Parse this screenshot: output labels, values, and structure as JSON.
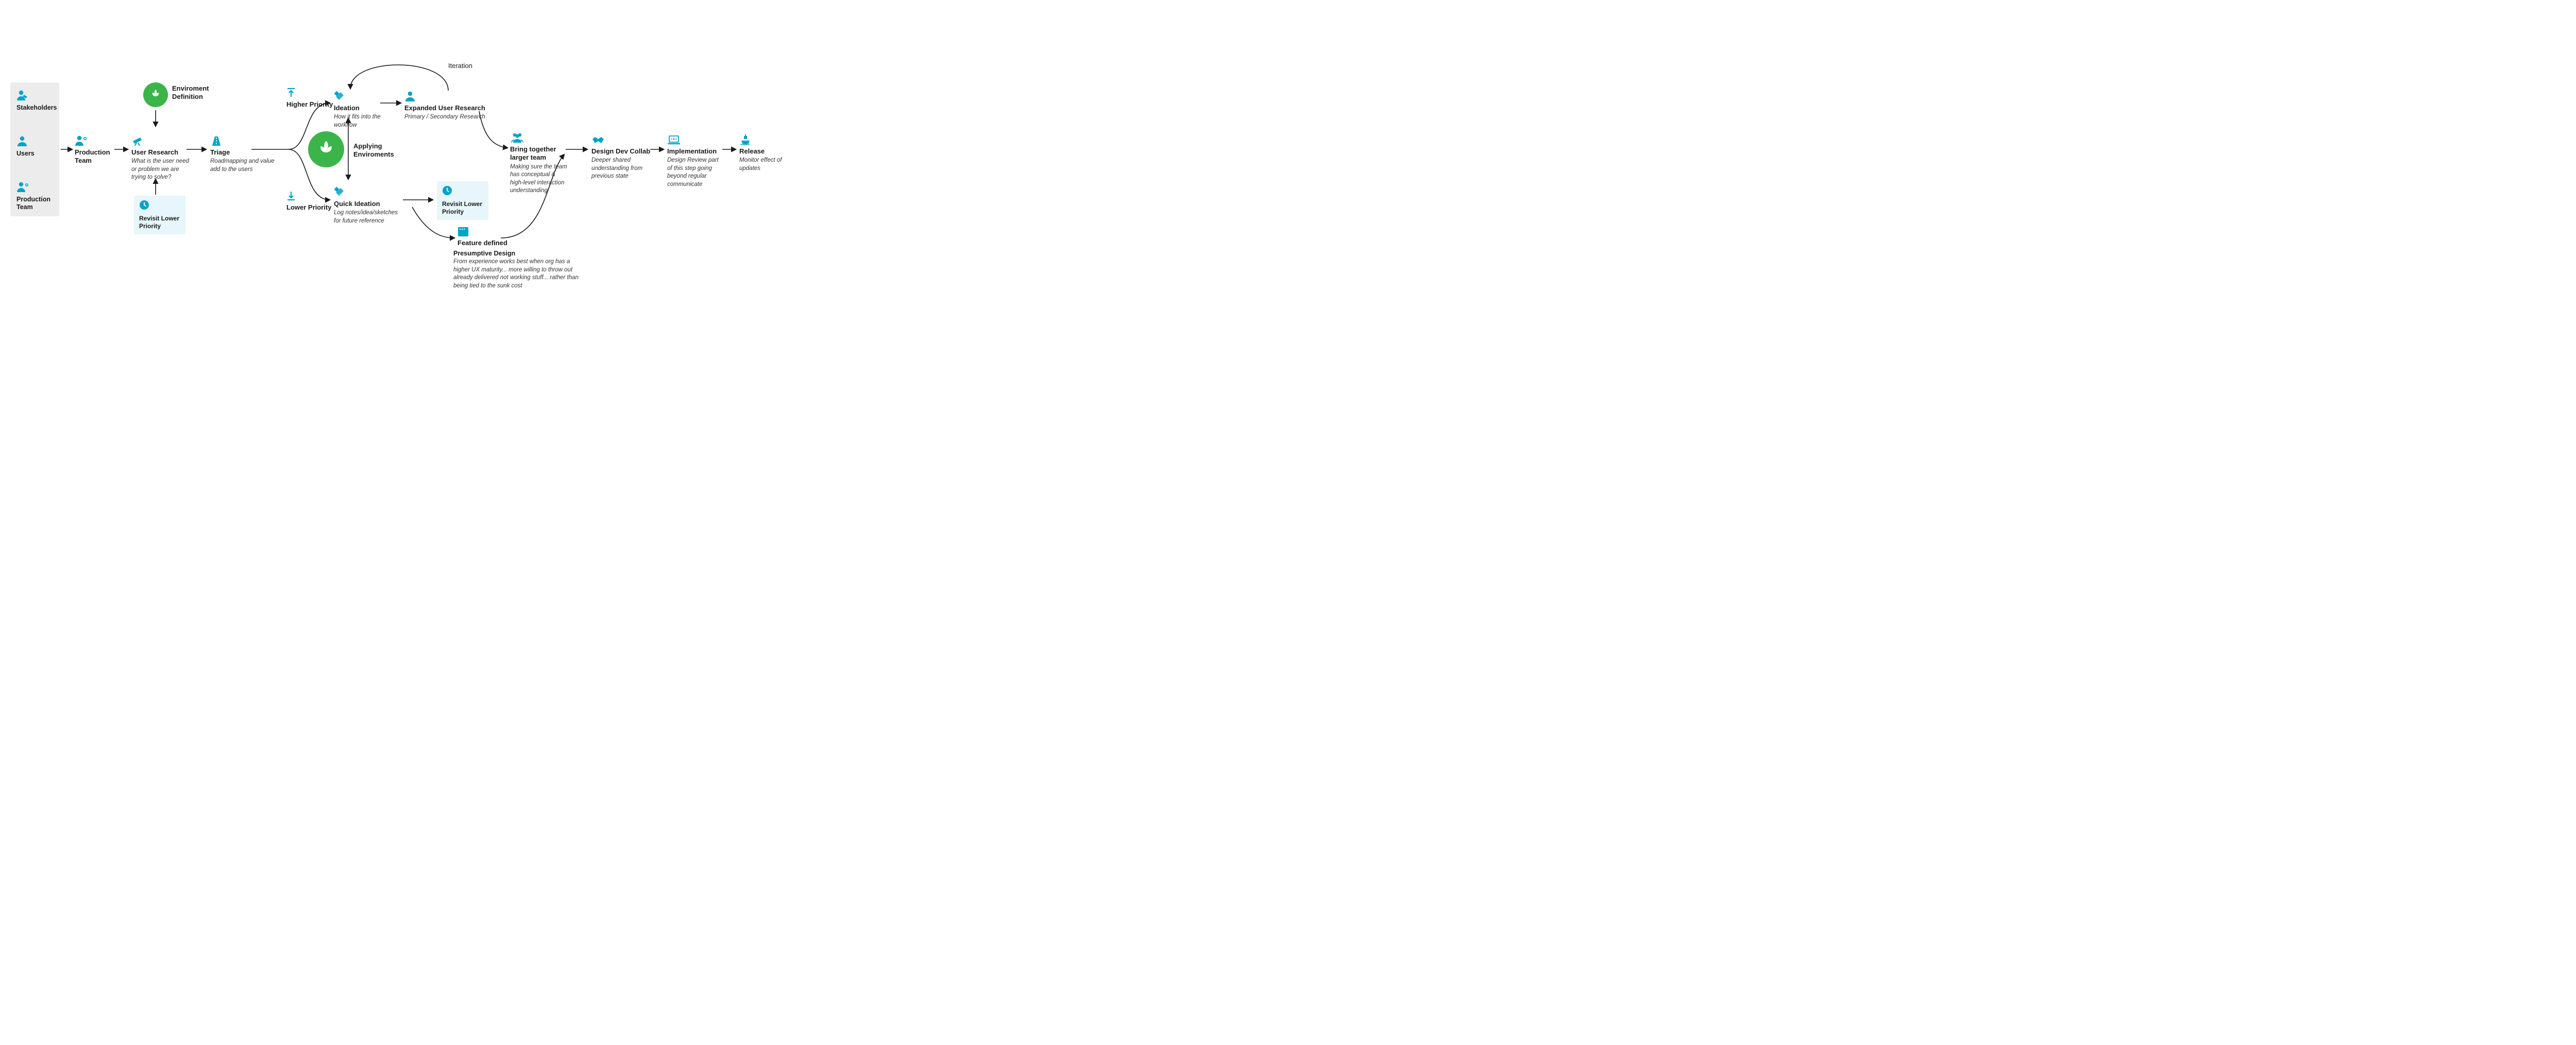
{
  "inputs": {
    "stakeholders": "Stakeholders",
    "users": "Users",
    "production_team": "Production Team"
  },
  "production_team": {
    "title": "Production Team"
  },
  "user_research": {
    "title": "User Research",
    "sub": "What is the user need or problem we are trying to solve?"
  },
  "env_def": {
    "title": "Enviroment Definition"
  },
  "revisit1": {
    "title": "Revisit Lower Priority"
  },
  "triage": {
    "title": "Triage",
    "sub": "Roadmapping and value add to the users"
  },
  "higher_priority": "Higher Priority",
  "lower_priority": "Lower Priority",
  "applying_env": "Applying Enviroments",
  "ideation": {
    "title": "Ideation",
    "sub": "How it fits into the workflow"
  },
  "quick_ideation": {
    "title": "Quick Ideation",
    "sub": "Log notes/idea/sketches for future reference"
  },
  "expanded_research": {
    "title": "Expanded User Research",
    "sub": "Primary / Secondary Research"
  },
  "iteration": "Iteration",
  "revisit2": {
    "title": "Revisit Lower Priority"
  },
  "feature_defined": {
    "title": "Feature defined"
  },
  "presumptive": {
    "title": "Presumptive Design",
    "sub": "From experience works best when org has a higher UX maturity... more willing to throw out already delivered not working stuff... rather than being tied to the sunk cost"
  },
  "bring_together": {
    "title": "Bring together larger team",
    "sub": "Making sure the team has conceptual & high-level interaction understanding"
  },
  "design_dev": {
    "title": "Design Dev Collab",
    "sub": "Deeper shared understanding from previous state"
  },
  "implementation": {
    "title": "Implementation",
    "sub": "Design Review part of this step going beyond regular communicate"
  },
  "release": {
    "title": "Release",
    "sub": "Monitor effect of updates"
  }
}
